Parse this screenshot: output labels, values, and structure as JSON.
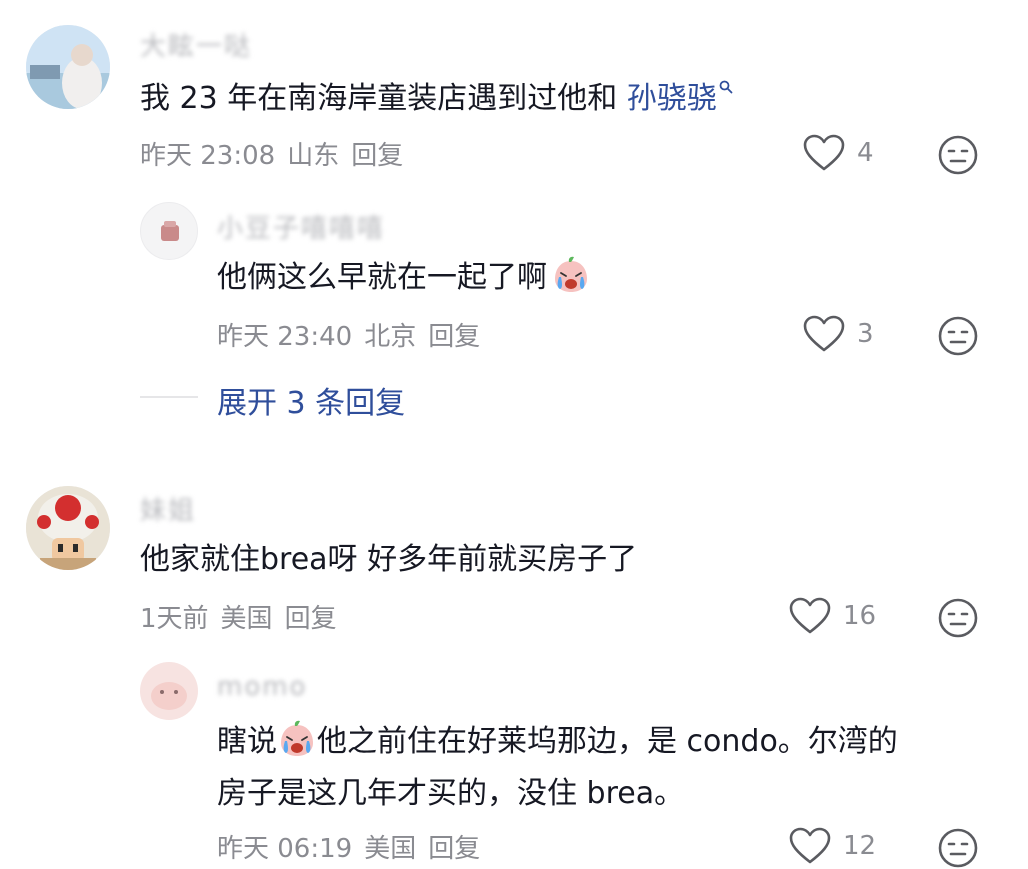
{
  "comments": [
    {
      "username": "大眩一哒",
      "text_prefix": "我 23 年在南海岸童装店遇到过他和 ",
      "mention": "孙骁骁",
      "time": "昨天 23:08",
      "location": "山东",
      "reply_label": "回复",
      "likes": "4",
      "replies": [
        {
          "username": "小豆子嘻嘻嘻",
          "text": "他俩这么早就在一起了啊",
          "time": "昨天 23:40",
          "location": "北京",
          "reply_label": "回复",
          "likes": "3"
        }
      ],
      "expand_label": "展开 3 条回复"
    },
    {
      "username": "妹姐",
      "text": "他家就住brea呀 好多年前就买房子了",
      "time": "1天前",
      "location": "美国",
      "reply_label": "回复",
      "likes": "16",
      "replies": [
        {
          "username": "momo",
          "text_line1_prefix": "瞎说",
          "text_line1_suffix": "他之前住在好莱坞那边，是 condo。尔湾的",
          "text_line2": "房子是这几年才买的，没住 brea。",
          "time": "昨天 06:19",
          "location": "美国",
          "reply_label": "回复",
          "likes": "12"
        }
      ]
    }
  ],
  "colors": {
    "text_primary": "#161823",
    "text_secondary": "#8a8b91",
    "mention": "#2f4e9b",
    "icon": "#5a5b60"
  },
  "icons": [
    "search-icon",
    "heart-icon",
    "dislike-face-icon",
    "crying-emoji-icon"
  ]
}
